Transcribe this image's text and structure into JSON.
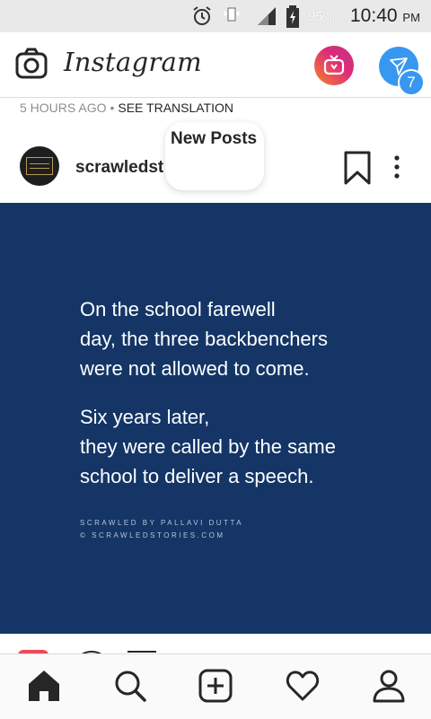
{
  "status_bar": {
    "battery_percent": "95%",
    "time": "10:40",
    "time_suffix": "PM",
    "icons": [
      "alarm-icon",
      "vibrate-icon",
      "signal-icon",
      "battery-charging-icon"
    ]
  },
  "header": {
    "brand": "Instagram",
    "dm_badge_count": "7",
    "icons": [
      "camera-icon",
      "igtv-icon",
      "direct-message-icon"
    ]
  },
  "previous_post": {
    "time_ago": "5 HOURS AGO",
    "separator": "•",
    "see_translation": "SEE TRANSLATION"
  },
  "post": {
    "username": "scrawledst",
    "new_posts_label": "New Posts",
    "quote_lines_1": [
      "On the school farewell",
      "day, the three backbenchers",
      "were not allowed to come."
    ],
    "quote_lines_2": [
      "Six years later,",
      "they were called by the same",
      "school to deliver a speech."
    ],
    "credit_line_1": "SCRAWLED BY PALLAVI DUTTA",
    "credit_line_2": "© SCRAWLEDSTORIES.COM",
    "image_bg": "#143566"
  },
  "bottom_nav": {
    "items": [
      "home-icon",
      "search-icon",
      "add-post-icon",
      "activity-heart-icon",
      "profile-icon"
    ]
  }
}
